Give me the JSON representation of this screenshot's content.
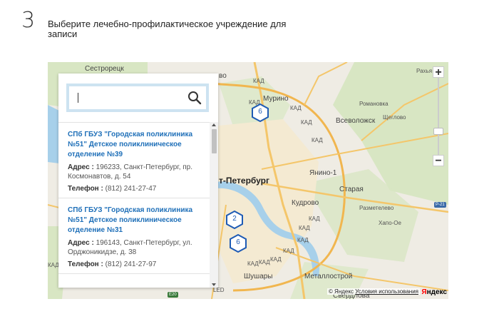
{
  "step": {
    "number": "3",
    "title": "Выберите лечебно-профилактическое учреждение для записи"
  },
  "search": {
    "value": "",
    "placeholder": ""
  },
  "clinics": [
    {
      "name": "СПб ГБУЗ \"Городская поликлиника №51\" Детское поликлиническое отделение №39",
      "address_label": "Адрес :",
      "address": "196233, Санкт-Петербург, пр. Космонавтов, д. 54",
      "phone_label": "Телефон :",
      "phone": "(812) 241-27-47"
    },
    {
      "name": "СПб ГБУЗ \"Городская поликлиника №51\" Детское поликлиническое отделение №31",
      "address_label": "Адрес :",
      "address": "196143, Санкт-Петербург, ул. Орджоникидзе, д. 38",
      "phone_label": "Телефон :",
      "phone": "(812) 241-27-97"
    }
  ],
  "map": {
    "labels": {
      "sestroretsk": "Сестрорецк",
      "murino": "Мурино",
      "vsevolozhsk": "Всеволожск",
      "romanovka": "Романовка",
      "shcheglovo": "Щеглово",
      "razhya": "Рахья",
      "spb": "т-Петербург",
      "yanino": "Янино-1",
      "staraya": "Старая",
      "kudrovo": "Кудрово",
      "razmetelevo": "Разметелево",
      "khapo_oe": "Хапо-Ое",
      "shushary": "Шушары",
      "metallostroy": "Металлострой",
      "sverdlova": "Свердлова",
      "kad1": "КАД",
      "kad2": "КАД",
      "kad3": "КАД",
      "kad4": "КАД",
      "kad5": "КАД",
      "kad6": "КАД",
      "kad7": "КАД",
      "kad8": "КАД",
      "kad9": "КАД",
      "kad10": "КАД",
      "kad11": "КАД",
      "kad12": "КАД",
      "kad13": "КАД",
      "led": "LED",
      "vo": "во"
    },
    "clusters": [
      "6",
      "2",
      "6"
    ],
    "road_badges": {
      "e20": "E20",
      "r21": "P-21"
    },
    "zoom_in": "+",
    "zoom_out": "−",
    "copyright_prefix": "© Яндекс",
    "copyright_link": "Условия использования",
    "logo_part1": "Я",
    "logo_part2": "ндекс"
  }
}
